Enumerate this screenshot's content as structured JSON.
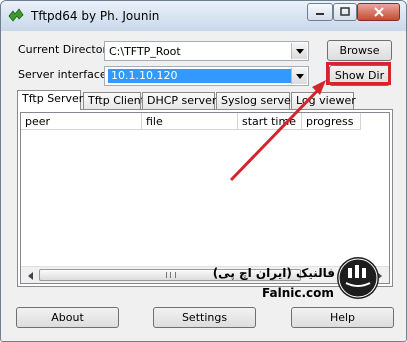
{
  "window": {
    "title": "Tftpd64 by Ph. Jounin",
    "controls": [
      "minimize",
      "maximize",
      "close"
    ]
  },
  "form": {
    "current_directory_label": "Current Directory",
    "current_directory_value": "C:\\TFTP_Root",
    "server_interface_label": "Server interface",
    "server_interface_value": "10.1.10.120"
  },
  "buttons": {
    "browse": "Browse",
    "show_dir": "Show Dir",
    "about": "About",
    "settings": "Settings",
    "help": "Help"
  },
  "tabs": [
    {
      "label": "Tftp Server",
      "active": true
    },
    {
      "label": "Tftp Client",
      "active": false
    },
    {
      "label": "DHCP server",
      "active": false
    },
    {
      "label": "Syslog server",
      "active": false
    },
    {
      "label": "Log viewer",
      "active": false
    }
  ],
  "table": {
    "columns": [
      "peer",
      "file",
      "start time",
      "progress"
    ],
    "rows": []
  },
  "watermark": {
    "brand_text": "فالنیک (ایران اچ پی)",
    "site": "Falnic.com"
  },
  "colors": {
    "highlight": "#d3262c",
    "selection": "#3399ff"
  }
}
